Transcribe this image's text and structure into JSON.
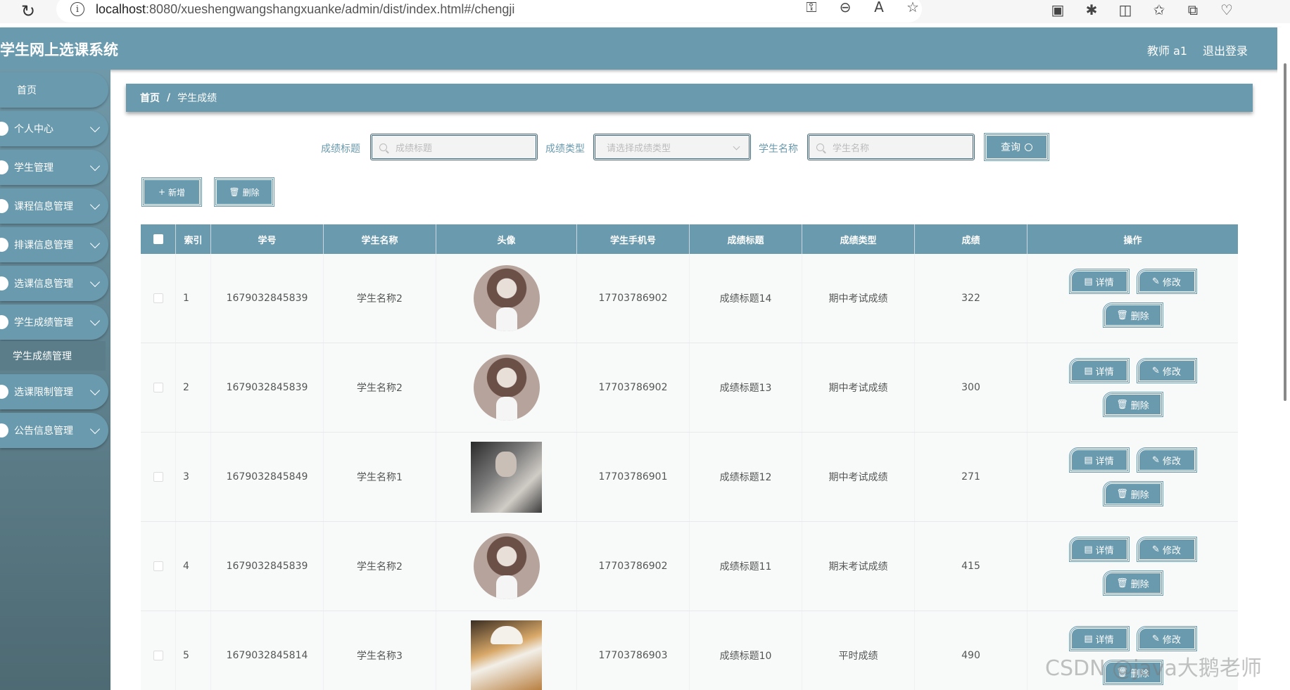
{
  "browser": {
    "url_host": "localhost",
    "url_rest": ":8080/xueshengwangshangxuanke/admin/dist/index.html#/chengji"
  },
  "header": {
    "app_title": "学生网上选课系统",
    "user_label": "教师 a1",
    "logout_label": "退出登录"
  },
  "sidebar": {
    "home": "首页",
    "items": [
      {
        "label": "个人中心"
      },
      {
        "label": "学生管理"
      },
      {
        "label": "课程信息管理"
      },
      {
        "label": "排课信息管理"
      },
      {
        "label": "选课信息管理"
      },
      {
        "label": "学生成绩管理"
      },
      {
        "label": "选课限制管理"
      },
      {
        "label": "公告信息管理"
      }
    ],
    "active_sub": "学生成绩管理"
  },
  "breadcrumb": {
    "home": "首页",
    "sep": "/",
    "current": "学生成绩"
  },
  "search": {
    "title_label": "成绩标题",
    "title_placeholder": "成绩标题",
    "type_label": "成绩类型",
    "type_placeholder": "请选择成绩类型",
    "student_label": "学生名称",
    "student_placeholder": "学生名称",
    "query_label": "查询"
  },
  "actions": {
    "add_label": "新增",
    "delete_label": "删除"
  },
  "table": {
    "headers": [
      "索引",
      "学号",
      "学生名称",
      "头像",
      "学生手机号",
      "成绩标题",
      "成绩类型",
      "成绩",
      "操作"
    ],
    "rows": [
      {
        "index": "1",
        "student_no": "1679032845839",
        "name": "学生名称2",
        "phone": "17703786902",
        "title": "成绩标题14",
        "type": "期中考试成绩",
        "score": "322",
        "avatar": "girl-avatar"
      },
      {
        "index": "2",
        "student_no": "1679032845839",
        "name": "学生名称2",
        "phone": "17703786902",
        "title": "成绩标题13",
        "type": "期中考试成绩",
        "score": "300",
        "avatar": "girl-avatar"
      },
      {
        "index": "3",
        "student_no": "1679032845849",
        "name": "学生名称1",
        "phone": "17703786901",
        "title": "成绩标题12",
        "type": "期中考试成绩",
        "score": "271",
        "avatar": "man-photo"
      },
      {
        "index": "4",
        "student_no": "1679032845839",
        "name": "学生名称2",
        "phone": "17703786902",
        "title": "成绩标题11",
        "type": "期末考试成绩",
        "score": "415",
        "avatar": "girl-avatar"
      },
      {
        "index": "5",
        "student_no": "1679032845814",
        "name": "学生名称3",
        "phone": "17703786903",
        "title": "成绩标题10",
        "type": "平时成绩",
        "score": "490",
        "avatar": "cat-photo"
      }
    ],
    "op_labels": {
      "detail": "详情",
      "edit": "修改",
      "delete": "删除"
    }
  },
  "watermark": "CSDN @java大鹅老师",
  "colors": {
    "accent": "#6a9aad",
    "sidebar_bottom": "#4e6a73"
  }
}
